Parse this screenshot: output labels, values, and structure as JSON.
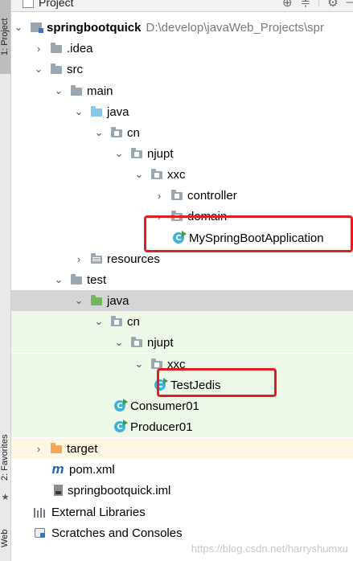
{
  "sidebar": {
    "project_tab": "1: Project",
    "favorites_tab": "2: Favorites",
    "web_tab": "Web"
  },
  "header": {
    "title": "Project",
    "controls": [
      "target-icon",
      "collapse-icon",
      "gear-icon",
      "minimize-icon"
    ]
  },
  "tree": {
    "root_name": "springbootquick",
    "root_path": "D:\\develop\\javaWeb_Projects\\spr",
    "idea": ".idea",
    "src": "src",
    "main": "main",
    "main_java": "java",
    "main_cn": "cn",
    "main_njupt": "njupt",
    "main_xxc": "xxc",
    "controller": "controller",
    "domain": "domain",
    "app_class": "MySpringBootApplication",
    "resources": "resources",
    "test": "test",
    "test_java": "java",
    "test_cn": "cn",
    "test_njupt": "njupt",
    "test_xxc": "xxc",
    "test_class": "TestJedis",
    "consumer": "Consumer01",
    "producer": "Producer01",
    "target": "target",
    "pom": "pom.xml",
    "iml": "springbootquick.iml",
    "external_libraries": "External Libraries",
    "scratches": "Scratches and Consoles",
    "class_icon_letter": "C",
    "maven_icon_letter": "m"
  },
  "watermark": "https://blog.csdn.net/harryshumxu",
  "colors": {
    "highlight_box": "#e02020",
    "test_background": "#eef8e9",
    "selected_row": "#d5d5d5"
  }
}
